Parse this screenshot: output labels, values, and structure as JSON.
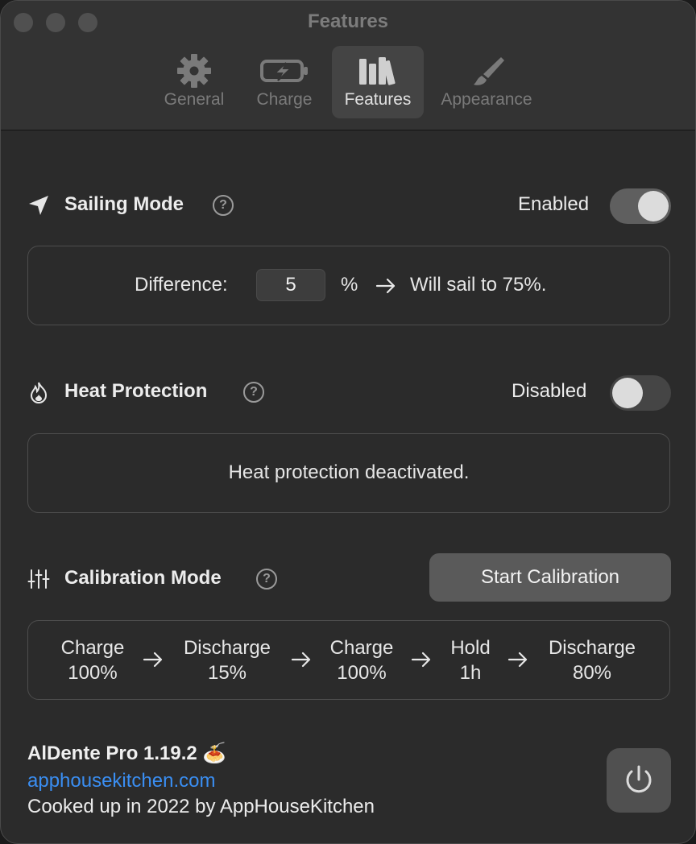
{
  "window": {
    "title": "Features"
  },
  "tabs": [
    {
      "label": "General",
      "icon": "gear-icon",
      "active": false
    },
    {
      "label": "Charge",
      "icon": "battery-charge-icon",
      "active": false
    },
    {
      "label": "Features",
      "icon": "books-icon",
      "active": true
    },
    {
      "label": "Appearance",
      "icon": "paintbrush-icon",
      "active": false
    }
  ],
  "sailing": {
    "title": "Sailing Mode",
    "help": "?",
    "state": "Enabled",
    "enabled": true,
    "difference_label": "Difference:",
    "difference_value": "5",
    "unit": "%",
    "arrow": "→",
    "result": "Will sail to 75%."
  },
  "heat": {
    "title": "Heat Protection",
    "help": "?",
    "state": "Disabled",
    "enabled": false,
    "message": "Heat protection deactivated."
  },
  "calibration": {
    "title": "Calibration Mode",
    "help": "?",
    "button": "Start Calibration",
    "steps": [
      {
        "action": "Charge",
        "value": "100%"
      },
      {
        "action": "Discharge",
        "value": "15%"
      },
      {
        "action": "Charge",
        "value": "100%"
      },
      {
        "action": "Hold",
        "value": "1h"
      },
      {
        "action": "Discharge",
        "value": "80%"
      }
    ]
  },
  "footer": {
    "app_name": "AlDente Pro 1.19.2 🍝",
    "link": "apphousekitchen.com",
    "credit": "Cooked up in 2022 by AppHouseKitchen"
  },
  "colors": {
    "accent_link": "#3a8ef2",
    "background": "#2b2b2b",
    "toolbar": "#333333"
  }
}
